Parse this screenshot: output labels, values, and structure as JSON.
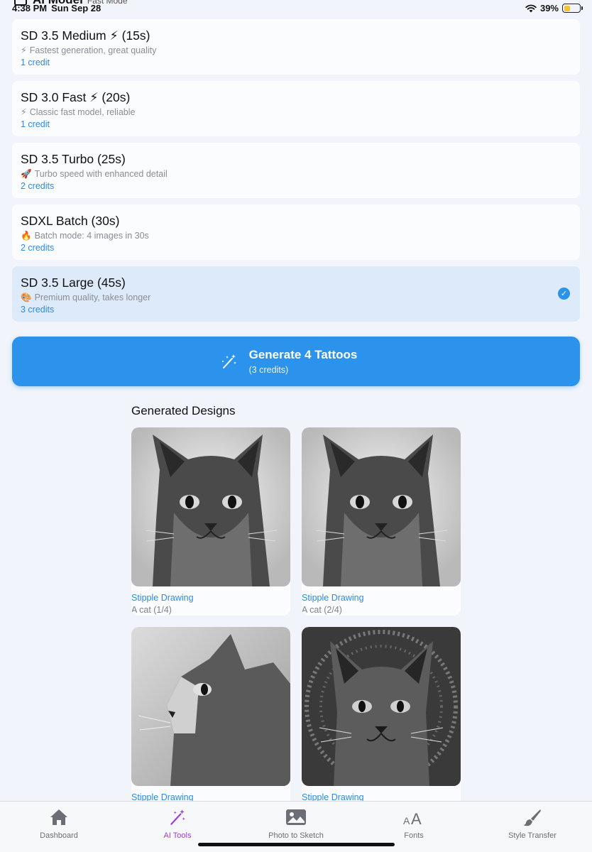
{
  "status": {
    "time": "4:38 PM",
    "date": "Sun Sep 28",
    "battery": "39%",
    "battery_level": 0.39,
    "peek_title": "AI Model",
    "peek_subtitle": "Fast Mode"
  },
  "models": [
    {
      "name": "SD 3.5 Medium ⚡ (15s)",
      "emoji": "⚡",
      "desc": "Fastest generation, great quality",
      "credits": "1 credit",
      "selected": false
    },
    {
      "name": "SD 3.0 Fast ⚡ (20s)",
      "emoji": "⚡",
      "desc": "Classic fast model, reliable",
      "credits": "1 credit",
      "selected": false
    },
    {
      "name": "SD 3.5 Turbo (25s)",
      "emoji": "🚀",
      "desc": "Turbo speed with enhanced detail",
      "credits": "2 credits",
      "selected": false
    },
    {
      "name": "SDXL Batch (30s)",
      "emoji": "🔥",
      "desc": "Batch mode: 4 images in 30s",
      "credits": "2 credits",
      "selected": false
    },
    {
      "name": "SD 3.5 Large (45s)",
      "emoji": "🎨",
      "desc": "Premium quality, takes longer",
      "credits": "3 credits",
      "selected": true
    }
  ],
  "generate": {
    "label": "Generate 4 Tattoos",
    "sub": "(3 credits)"
  },
  "designs": {
    "title": "Generated Designs",
    "items": [
      {
        "style": "Stipple Drawing",
        "caption": "A cat (1/4)"
      },
      {
        "style": "Stipple Drawing",
        "caption": "A cat (2/4)"
      },
      {
        "style": "Stipple Drawing",
        "caption": ""
      },
      {
        "style": "Stipple Drawing",
        "caption": ""
      }
    ]
  },
  "tabs": [
    {
      "label": "Dashboard",
      "icon": "house-icon",
      "active": false
    },
    {
      "label": "AI Tools",
      "icon": "magic-wand-icon",
      "active": true
    },
    {
      "label": "Photo to Sketch",
      "icon": "photo-icon",
      "active": false
    },
    {
      "label": "Fonts",
      "icon": "font-size-icon",
      "active": false
    },
    {
      "label": "Style Transfer",
      "icon": "paintbrush-icon",
      "active": false
    }
  ],
  "colors": {
    "accent": "#2b93ec",
    "selected_card": "#dceafa",
    "active_tab": "#a33be0",
    "credits_text": "#2a8be0"
  }
}
